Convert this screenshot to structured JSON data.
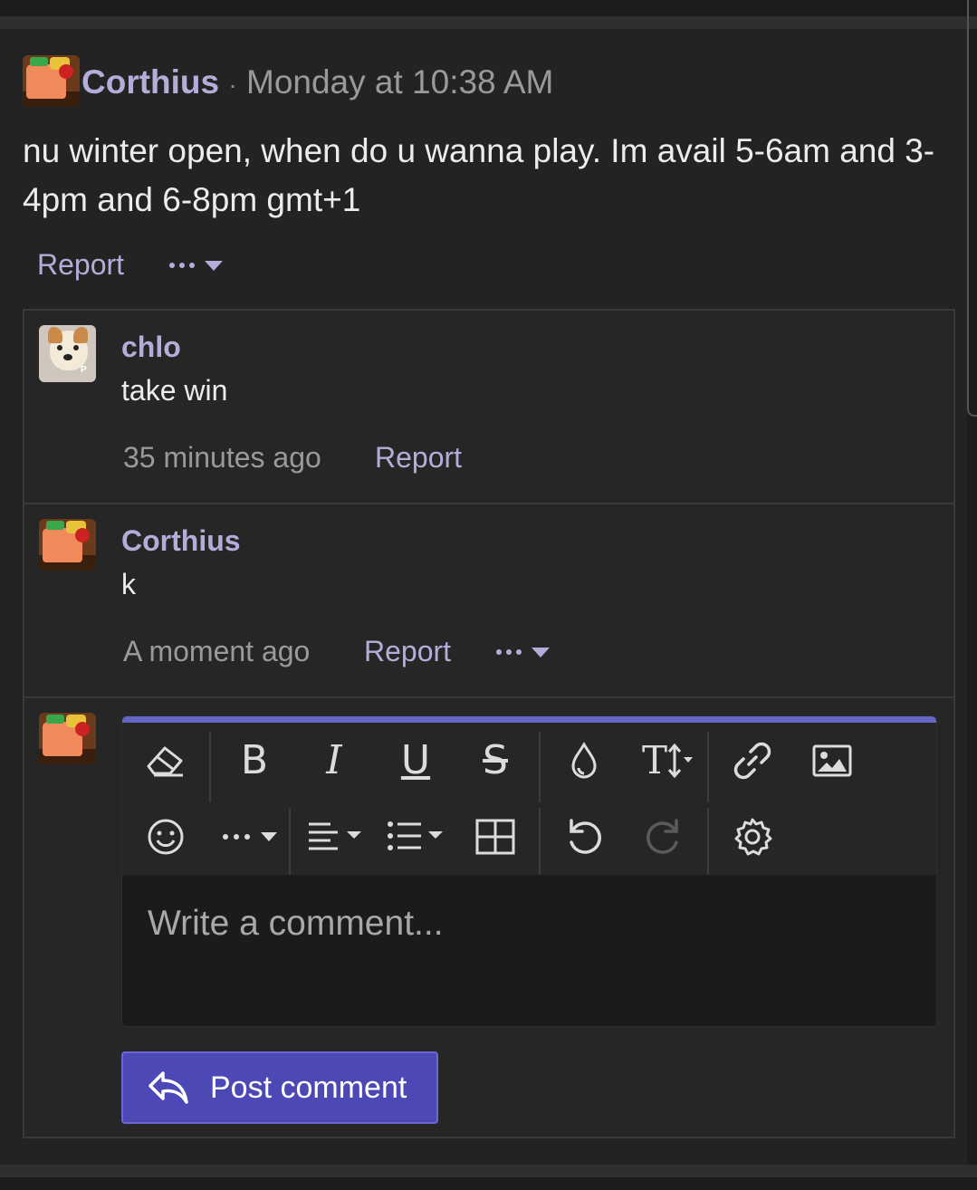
{
  "post": {
    "author": "Corthius",
    "separator": "·",
    "date": "Monday at 10:38 AM",
    "text": "nu winter open, when do u wanna play. Im avail 5-6am and 3-4pm and 6-8pm gmt+1",
    "report_label": "Report"
  },
  "comments": [
    {
      "author": "chlo",
      "text": "take win",
      "time": "35 minutes ago",
      "report_label": "Report"
    },
    {
      "author": "Corthius",
      "text": "k",
      "time": "A moment ago",
      "report_label": "Report"
    }
  ],
  "editor": {
    "placeholder": "Write a comment...",
    "toolbar_icons": [
      "eraser-icon",
      "bold-icon",
      "italic-icon",
      "underline-icon",
      "strikethrough-icon",
      "text-color-icon",
      "text-size-icon",
      "link-icon",
      "image-icon",
      "emoji-icon",
      "more-options-icon",
      "align-icon",
      "list-icon",
      "table-icon",
      "undo-icon",
      "redo-icon",
      "settings-icon"
    ],
    "bold_glyph": "B",
    "italic_glyph": "I",
    "underline_glyph": "U",
    "strike_glyph": "S",
    "size_glyph": "T"
  },
  "post_button": {
    "label": "Post comment"
  },
  "colors": {
    "accent": "#b3aed9",
    "button": "#4c48b5",
    "editor_bar": "#6466c4",
    "background": "#232323"
  }
}
